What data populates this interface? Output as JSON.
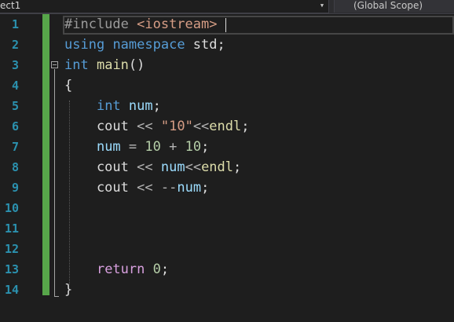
{
  "navbar": {
    "project_label": "ect1",
    "scope_label": "(Global Scope)",
    "arrow_icon": "chevron-down-icon"
  },
  "editor": {
    "line_numbers": [
      "1",
      "2",
      "3",
      "4",
      "5",
      "6",
      "7",
      "8",
      "9",
      "10",
      "11",
      "12",
      "13",
      "14"
    ],
    "lines": [
      {
        "tokens": [
          {
            "t": "#include ",
            "k": "directive"
          },
          {
            "t": "<iostream>",
            "k": "header"
          }
        ]
      },
      {
        "tokens": [
          {
            "t": "using",
            "k": "keyword"
          },
          {
            "t": " ",
            "k": "punct"
          },
          {
            "t": "namespace",
            "k": "keyword"
          },
          {
            "t": " std;",
            "k": "ident"
          }
        ]
      },
      {
        "tokens": [
          {
            "t": "int",
            "k": "keyword"
          },
          {
            "t": " ",
            "k": "punct"
          },
          {
            "t": "main",
            "k": "func"
          },
          {
            "t": "()",
            "k": "punct"
          }
        ]
      },
      {
        "tokens": [
          {
            "t": "{",
            "k": "punct"
          }
        ]
      },
      {
        "tokens": [
          {
            "t": "    ",
            "k": "punct"
          },
          {
            "t": "int",
            "k": "keyword"
          },
          {
            "t": " ",
            "k": "punct"
          },
          {
            "t": "num",
            "k": "var"
          },
          {
            "t": ";",
            "k": "punct"
          }
        ]
      },
      {
        "tokens": [
          {
            "t": "    cout ",
            "k": "ident"
          },
          {
            "t": "<<",
            "k": "op"
          },
          {
            "t": " ",
            "k": "punct"
          },
          {
            "t": "\"10\"",
            "k": "string"
          },
          {
            "t": "<<",
            "k": "op"
          },
          {
            "t": "endl",
            "k": "func"
          },
          {
            "t": ";",
            "k": "punct"
          }
        ]
      },
      {
        "tokens": [
          {
            "t": "    ",
            "k": "punct"
          },
          {
            "t": "num",
            "k": "var"
          },
          {
            "t": " = ",
            "k": "op"
          },
          {
            "t": "10",
            "k": "number"
          },
          {
            "t": " + ",
            "k": "op"
          },
          {
            "t": "10",
            "k": "number"
          },
          {
            "t": ";",
            "k": "punct"
          }
        ]
      },
      {
        "tokens": [
          {
            "t": "    cout ",
            "k": "ident"
          },
          {
            "t": "<<",
            "k": "op"
          },
          {
            "t": " ",
            "k": "punct"
          },
          {
            "t": "num",
            "k": "var"
          },
          {
            "t": "<<",
            "k": "op"
          },
          {
            "t": "endl",
            "k": "func"
          },
          {
            "t": ";",
            "k": "punct"
          }
        ]
      },
      {
        "tokens": [
          {
            "t": "    cout ",
            "k": "ident"
          },
          {
            "t": "<<",
            "k": "op"
          },
          {
            "t": " ",
            "k": "punct"
          },
          {
            "t": "--",
            "k": "op"
          },
          {
            "t": "num",
            "k": "var"
          },
          {
            "t": ";",
            "k": "punct"
          }
        ]
      },
      {
        "tokens": []
      },
      {
        "tokens": []
      },
      {
        "tokens": []
      },
      {
        "tokens": [
          {
            "t": "    ",
            "k": "punct"
          },
          {
            "t": "return",
            "k": "control"
          },
          {
            "t": " ",
            "k": "punct"
          },
          {
            "t": "0",
            "k": "number"
          },
          {
            "t": ";",
            "k": "punct"
          }
        ]
      },
      {
        "tokens": [
          {
            "t": "}",
            "k": "punct"
          }
        ]
      }
    ]
  },
  "colors": {
    "background": "#1e1e1e",
    "line_number": "#2b91af",
    "change_bar": "#57a64a",
    "keyword": "#569cd6",
    "control": "#d8a0df",
    "string": "#d69d85",
    "number": "#b5cea8",
    "variable": "#9cdcfe",
    "function": "#dcdcaa"
  }
}
